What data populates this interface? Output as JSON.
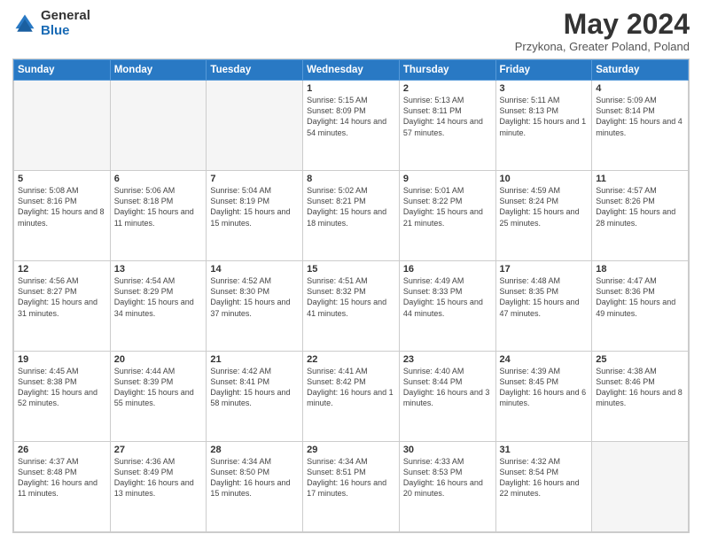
{
  "logo": {
    "general": "General",
    "blue": "Blue"
  },
  "header": {
    "month_year": "May 2024",
    "location": "Przykona, Greater Poland, Poland"
  },
  "days_of_week": [
    "Sunday",
    "Monday",
    "Tuesday",
    "Wednesday",
    "Thursday",
    "Friday",
    "Saturday"
  ],
  "weeks": [
    [
      {
        "num": "",
        "info": ""
      },
      {
        "num": "",
        "info": ""
      },
      {
        "num": "",
        "info": ""
      },
      {
        "num": "1",
        "info": "Sunrise: 5:15 AM\nSunset: 8:09 PM\nDaylight: 14 hours and 54 minutes."
      },
      {
        "num": "2",
        "info": "Sunrise: 5:13 AM\nSunset: 8:11 PM\nDaylight: 14 hours and 57 minutes."
      },
      {
        "num": "3",
        "info": "Sunrise: 5:11 AM\nSunset: 8:13 PM\nDaylight: 15 hours and 1 minute."
      },
      {
        "num": "4",
        "info": "Sunrise: 5:09 AM\nSunset: 8:14 PM\nDaylight: 15 hours and 4 minutes."
      }
    ],
    [
      {
        "num": "5",
        "info": "Sunrise: 5:08 AM\nSunset: 8:16 PM\nDaylight: 15 hours and 8 minutes."
      },
      {
        "num": "6",
        "info": "Sunrise: 5:06 AM\nSunset: 8:18 PM\nDaylight: 15 hours and 11 minutes."
      },
      {
        "num": "7",
        "info": "Sunrise: 5:04 AM\nSunset: 8:19 PM\nDaylight: 15 hours and 15 minutes."
      },
      {
        "num": "8",
        "info": "Sunrise: 5:02 AM\nSunset: 8:21 PM\nDaylight: 15 hours and 18 minutes."
      },
      {
        "num": "9",
        "info": "Sunrise: 5:01 AM\nSunset: 8:22 PM\nDaylight: 15 hours and 21 minutes."
      },
      {
        "num": "10",
        "info": "Sunrise: 4:59 AM\nSunset: 8:24 PM\nDaylight: 15 hours and 25 minutes."
      },
      {
        "num": "11",
        "info": "Sunrise: 4:57 AM\nSunset: 8:26 PM\nDaylight: 15 hours and 28 minutes."
      }
    ],
    [
      {
        "num": "12",
        "info": "Sunrise: 4:56 AM\nSunset: 8:27 PM\nDaylight: 15 hours and 31 minutes."
      },
      {
        "num": "13",
        "info": "Sunrise: 4:54 AM\nSunset: 8:29 PM\nDaylight: 15 hours and 34 minutes."
      },
      {
        "num": "14",
        "info": "Sunrise: 4:52 AM\nSunset: 8:30 PM\nDaylight: 15 hours and 37 minutes."
      },
      {
        "num": "15",
        "info": "Sunrise: 4:51 AM\nSunset: 8:32 PM\nDaylight: 15 hours and 41 minutes."
      },
      {
        "num": "16",
        "info": "Sunrise: 4:49 AM\nSunset: 8:33 PM\nDaylight: 15 hours and 44 minutes."
      },
      {
        "num": "17",
        "info": "Sunrise: 4:48 AM\nSunset: 8:35 PM\nDaylight: 15 hours and 47 minutes."
      },
      {
        "num": "18",
        "info": "Sunrise: 4:47 AM\nSunset: 8:36 PM\nDaylight: 15 hours and 49 minutes."
      }
    ],
    [
      {
        "num": "19",
        "info": "Sunrise: 4:45 AM\nSunset: 8:38 PM\nDaylight: 15 hours and 52 minutes."
      },
      {
        "num": "20",
        "info": "Sunrise: 4:44 AM\nSunset: 8:39 PM\nDaylight: 15 hours and 55 minutes."
      },
      {
        "num": "21",
        "info": "Sunrise: 4:42 AM\nSunset: 8:41 PM\nDaylight: 15 hours and 58 minutes."
      },
      {
        "num": "22",
        "info": "Sunrise: 4:41 AM\nSunset: 8:42 PM\nDaylight: 16 hours and 1 minute."
      },
      {
        "num": "23",
        "info": "Sunrise: 4:40 AM\nSunset: 8:44 PM\nDaylight: 16 hours and 3 minutes."
      },
      {
        "num": "24",
        "info": "Sunrise: 4:39 AM\nSunset: 8:45 PM\nDaylight: 16 hours and 6 minutes."
      },
      {
        "num": "25",
        "info": "Sunrise: 4:38 AM\nSunset: 8:46 PM\nDaylight: 16 hours and 8 minutes."
      }
    ],
    [
      {
        "num": "26",
        "info": "Sunrise: 4:37 AM\nSunset: 8:48 PM\nDaylight: 16 hours and 11 minutes."
      },
      {
        "num": "27",
        "info": "Sunrise: 4:36 AM\nSunset: 8:49 PM\nDaylight: 16 hours and 13 minutes."
      },
      {
        "num": "28",
        "info": "Sunrise: 4:34 AM\nSunset: 8:50 PM\nDaylight: 16 hours and 15 minutes."
      },
      {
        "num": "29",
        "info": "Sunrise: 4:34 AM\nSunset: 8:51 PM\nDaylight: 16 hours and 17 minutes."
      },
      {
        "num": "30",
        "info": "Sunrise: 4:33 AM\nSunset: 8:53 PM\nDaylight: 16 hours and 20 minutes."
      },
      {
        "num": "31",
        "info": "Sunrise: 4:32 AM\nSunset: 8:54 PM\nDaylight: 16 hours and 22 minutes."
      },
      {
        "num": "",
        "info": ""
      }
    ]
  ]
}
